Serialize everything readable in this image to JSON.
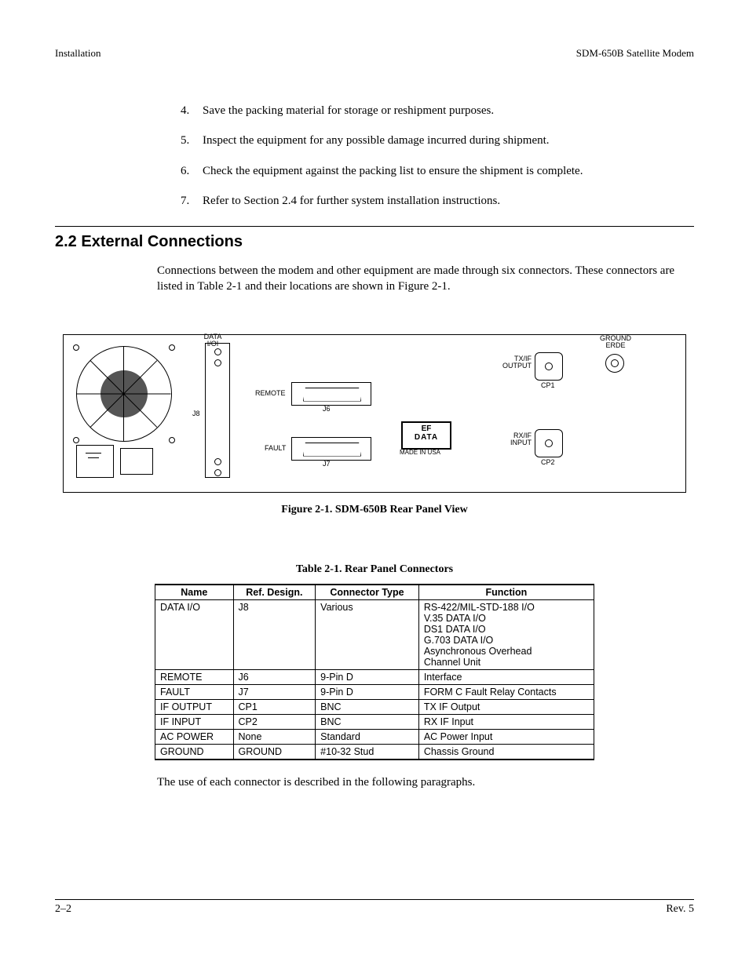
{
  "header": {
    "left": "Installation",
    "right": "SDM-650B Satellite Modem"
  },
  "list": [
    {
      "num": "4.",
      "text": "Save the packing material for storage or reshipment purposes."
    },
    {
      "num": "5.",
      "text": "Inspect the equipment for any possible damage incurred during shipment."
    },
    {
      "num": "6.",
      "text": "Check the equipment against the packing list to ensure the shipment is complete."
    },
    {
      "num": "7.",
      "text": "Refer to Section 2.4 for further system installation instructions."
    }
  ],
  "section": {
    "heading": "2.2  External Connections",
    "body": "Connections between the modem and other equipment are made through six connectors. These connectors are listed in Table 2-1 and their locations are shown in Figure 2-1."
  },
  "figure": {
    "caption": "Figure 2-1.  SDM-650B Rear Panel View",
    "labels": {
      "data_io": "DATA\nI/OI",
      "j8": "J8",
      "remote": "REMOTE",
      "j6": "J6",
      "fault": "FAULT",
      "j7": "J7",
      "logo_top": "EF",
      "logo_bottom": "DATA",
      "made": "MADE IN USA",
      "txif": "TX/IF\nOUTPUT",
      "cp1": "CP1",
      "rxif": "RX/IF\nINPUT",
      "cp2": "CP2",
      "ground": "GROUND\nERDE"
    }
  },
  "table": {
    "caption": "Table 2-1.  Rear Panel Connectors",
    "headers": [
      "Name",
      "Ref. Design.",
      "Connector Type",
      "Function"
    ],
    "rows": [
      {
        "c": [
          "DATA I/O",
          "J8",
          "Various",
          "RS-422/MIL-STD-188 I/O\nV.35 DATA I/O\nDS1 DATA I/O\nG.703 DATA I/O\nAsynchronous Overhead\nChannel Unit"
        ]
      },
      {
        "c": [
          "REMOTE",
          "J6",
          "9-Pin D",
          "Interface"
        ]
      },
      {
        "c": [
          "FAULT",
          "J7",
          "9-Pin D",
          "FORM C Fault Relay Contacts"
        ]
      },
      {
        "c": [
          "IF OUTPUT",
          "CP1",
          "BNC",
          "TX IF Output"
        ]
      },
      {
        "c": [
          "IF INPUT",
          "CP2",
          "BNC",
          "RX IF Input"
        ]
      },
      {
        "c": [
          "AC POWER",
          "None",
          "Standard",
          "AC Power Input"
        ]
      },
      {
        "c": [
          "GROUND",
          "GROUND",
          "#10-32 Stud",
          "Chassis Ground"
        ]
      }
    ]
  },
  "after_table": "The use of each connector is described in the following paragraphs.",
  "footer": {
    "left": "2–2",
    "right": "Rev. 5"
  }
}
